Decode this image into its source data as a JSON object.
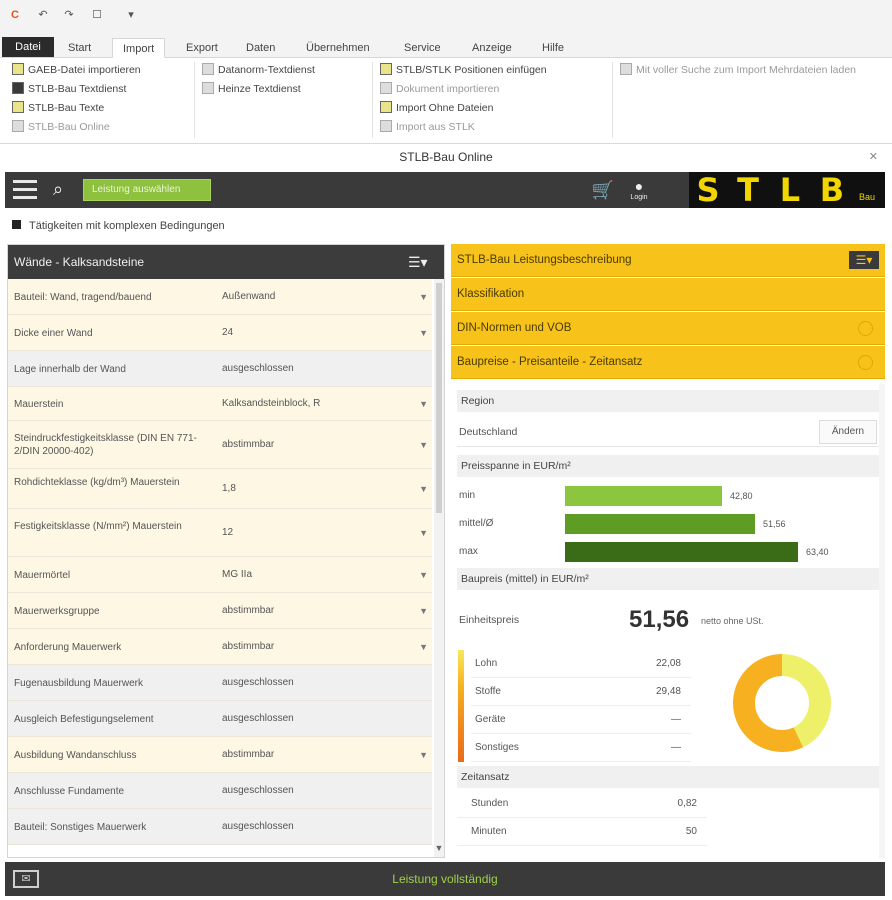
{
  "quick_access": [
    "app-icon",
    "undo-icon",
    "redo-icon",
    "window-icon",
    "dropdown-icon"
  ],
  "ribbon_tabs": [
    {
      "label": "Datei",
      "state": "file"
    },
    {
      "label": "Start",
      "state": ""
    },
    {
      "label": "Import",
      "state": "active"
    },
    {
      "label": "Export",
      "state": ""
    },
    {
      "label": "Daten",
      "state": ""
    },
    {
      "label": "Übernehmen",
      "state": ""
    },
    {
      "label": "Service",
      "state": ""
    },
    {
      "label": "Anzeige",
      "state": ""
    },
    {
      "label": "Hilfe",
      "state": ""
    }
  ],
  "ribbon": {
    "group1": [
      "GAEB-Datei importieren",
      "STLB-Bau Textdienst",
      "STLB-Bau Texte",
      "STLB-Bau Online"
    ],
    "group2": [
      "Datanorm-Textdienst",
      "Heinze Textdienst"
    ],
    "group3": [
      "STLB/STLK Positionen einfügen",
      "Dokument importieren",
      "Import Ohne Dateien",
      "Import aus STLK"
    ],
    "group4": "Mit voller Suche zum Import Mehrdateien laden"
  },
  "window_title": "STLB-Bau Online",
  "toolbar": {
    "search_placeholder": "Leistung auswählen",
    "logo_letters": [
      "S",
      "T",
      "L",
      "B"
    ],
    "logo_sub": "Bau",
    "user_label": "Login"
  },
  "option_row": "Tätigkeiten mit komplexen Bedingungen",
  "left_panel": {
    "title": "Wände - Kalksandsteine",
    "rows": [
      {
        "label": "Bauteil: Wand, tragend/bauend",
        "value": "Außenwand",
        "dd": true,
        "shade": "y"
      },
      {
        "label": "Dicke einer Wand",
        "value": "24",
        "dd": true,
        "shade": "y"
      },
      {
        "label": "Lage innerhalb der Wand",
        "value": "ausgeschlossen",
        "dd": false,
        "shade": "g"
      },
      {
        "label": "Mauerstein",
        "value": "Kalksandsteinblock, R",
        "dd": true,
        "shade": "y"
      },
      {
        "label": "Steindruckfestigkeitsklasse (DIN EN 771-2/DIN 20000-402)",
        "value": "abstimmbar",
        "dd": true,
        "shade": "y"
      },
      {
        "label": "Rohdichteklasse (kg/dm³) Mauerstein",
        "value": "1,8",
        "dd": true,
        "shade": "y"
      },
      {
        "label": "Festigkeitsklasse (N/mm²) Mauerstein",
        "value": "12",
        "dd": true,
        "shade": "y"
      },
      {
        "label": "Mauermörtel",
        "value": "MG IIa",
        "dd": true,
        "shade": "y"
      },
      {
        "label": "Mauerwerksgruppe",
        "value": "abstimmbar",
        "dd": true,
        "shade": "y"
      },
      {
        "label": "Anforderung Mauerwerk",
        "value": "abstimmbar",
        "dd": true,
        "shade": "y"
      },
      {
        "label": "Fugenausbildung Mauerwerk",
        "value": "ausgeschlossen",
        "dd": false,
        "shade": "g"
      },
      {
        "label": "Ausgleich Befestigungselement",
        "value": "ausgeschlossen",
        "dd": false,
        "shade": "g"
      },
      {
        "label": "Ausbildung Wandanschluss",
        "value": "abstimmbar",
        "dd": true,
        "shade": "y"
      },
      {
        "label": "Anschlusse Fundamente",
        "value": "ausgeschlossen",
        "dd": false,
        "shade": "g"
      },
      {
        "label": "Bauteil: Sonstiges Mauerwerk",
        "value": "ausgeschlossen",
        "dd": false,
        "shade": "g"
      }
    ]
  },
  "right_panel": {
    "sections": [
      {
        "title": "STLB-Bau Leistungsbeschreibung",
        "kind": "menu"
      },
      {
        "title": "Klassifikation",
        "kind": "none"
      },
      {
        "title": "DIN-Normen und VOB",
        "kind": "circle"
      },
      {
        "title": "Baupreise - Preisanteile - Zeitansatz",
        "kind": "circle"
      }
    ],
    "region_label": "Region",
    "region_value": "Deutschland",
    "region_button": "Ändern",
    "price_header": "Preisspanne in EUR/m²",
    "price_rows": [
      {
        "label": "min",
        "value": 42.8,
        "display": "42,80",
        "color": "#8cc63f"
      },
      {
        "label": "mittel/Ø",
        "value": 51.56,
        "display": "51,56",
        "color": "#5e9c23"
      },
      {
        "label": "max",
        "value": 63.4,
        "display": "63,40",
        "color": "#3a6b16"
      }
    ],
    "price_max": 68,
    "bau_header": "Baupreis (mittel) in EUR/m²",
    "total_label": "Einheitspreis",
    "total_value": "51,56",
    "total_unit": "netto ohne USt.",
    "legend": [
      {
        "label": "Lohn",
        "value": "22,08",
        "color": "#f5e95a"
      },
      {
        "label": "Stoffe",
        "value": "29,48",
        "color": "#f6b020"
      },
      {
        "label": "Geräte",
        "value": "—",
        "color": "#f08a1c"
      },
      {
        "label": "Sonstiges",
        "value": "—",
        "color": "#e86b1a"
      }
    ],
    "donut": [
      {
        "label": "Lohn",
        "value": 22.08,
        "color": "#eef06a"
      },
      {
        "label": "Stoffe",
        "value": 29.48,
        "color": "#f6b020"
      }
    ],
    "time_header": "Zeitansatz",
    "time_rows": [
      {
        "label": "Stunden",
        "value": "0,82"
      },
      {
        "label": "Minuten",
        "value": "50"
      }
    ]
  },
  "status": "Leistung vollständig"
}
